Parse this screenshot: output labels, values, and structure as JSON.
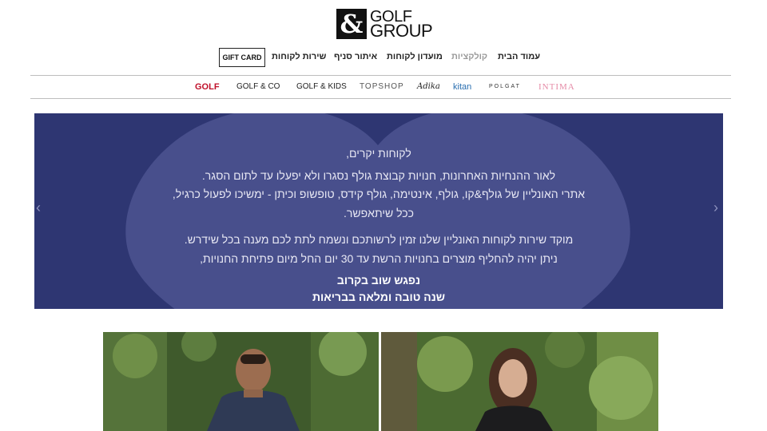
{
  "logo": {
    "mark": "&",
    "line1": "GOLF",
    "line2": "GROUP"
  },
  "nav": {
    "home": "עמוד הבית",
    "collections": "קולקציות",
    "club": "מועדון לקוחות",
    "store_locator": "איתור סניף",
    "service": "שירות לקוחות",
    "gift_card": "GIFT CARD"
  },
  "brands": {
    "golf": "GOLF",
    "golf_co": "GOLF & CO",
    "golf_kids": "GOLF & KIDS",
    "topshop": "TOPSHOP",
    "adika": "Adika",
    "kitan": "kitan",
    "polgat": "POLGAT",
    "intima": "INTIMA"
  },
  "banner": {
    "greeting": "לקוחות יקרים,",
    "line1": "לאור ההנחיות האחרונות, חנויות קבוצת גולף נסגרו ולא יפעלו עד לתום הסגר.",
    "line2": "אתרי האונליין של גולף&קו, גולף, אינטימה, גולף קידס, טופשופ וכיתן - ימשיכו לפעול כרגיל,",
    "line3": "ככל שיתאפשר.",
    "line4": "מוקד שירות לקוחות האונליין שלנו זמין לרשותכם ונשמח לתת לכם מענה בכל שידרש.",
    "line5": "ניתן יהיה להחליף מוצרים בחנויות הרשת עד 30 יום החל מיום פתיחת החנויות,",
    "line6": "נפגש שוב בקרוב",
    "line7": "שנה טובה ומלאה בבריאות",
    "prev": "‹",
    "next": "›"
  },
  "colors": {
    "banner_bg": "#2e3672",
    "heart": "#484f8c",
    "golf_red": "#c0102a",
    "intima_pink": "#e58aa6",
    "kitan_blue": "#2a6fb0"
  }
}
